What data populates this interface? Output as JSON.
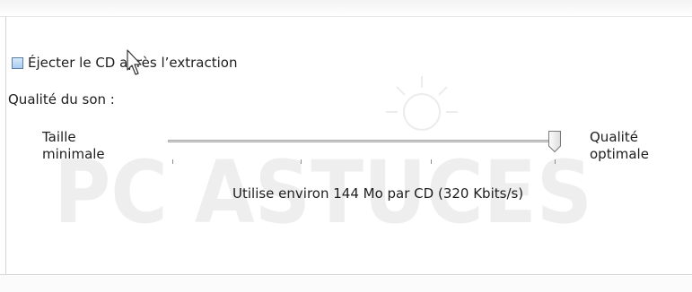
{
  "options": {
    "eject_label": "Éjecter le CD après l’extraction",
    "eject_checked": false
  },
  "audio_quality": {
    "section_label": "Qualité du son :",
    "min_label": "Taille\nminimale",
    "max_label": "Qualité\noptimale",
    "slider_value": 1.0,
    "info_text": "Utilise environ 144 Mo par CD (320 Kbits/s)"
  },
  "watermark_text": "PC ASTUCES",
  "colors": {
    "checkbox_fill": "#a9cdf2",
    "checkbox_border": "#5d7ea8",
    "track": "#e2e2e2",
    "watermark": "#ececec"
  }
}
